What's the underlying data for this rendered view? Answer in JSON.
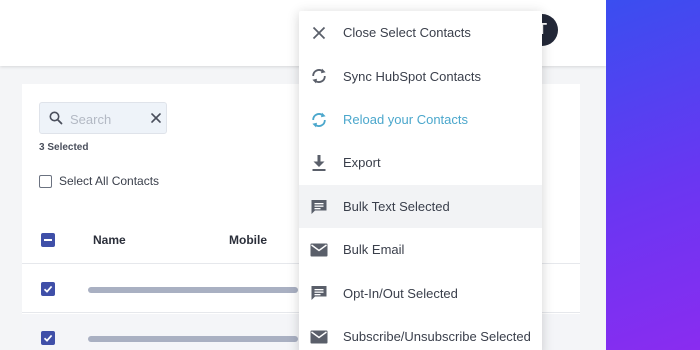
{
  "header": {
    "avatar_initial": "T"
  },
  "search": {
    "placeholder": "Search",
    "value": ""
  },
  "selection": {
    "count_text": "3 Selected",
    "select_all_label": "Select All Contacts"
  },
  "table": {
    "columns": [
      "Name",
      "Mobile"
    ],
    "rows": [
      {
        "checked": true
      },
      {
        "checked": true
      }
    ]
  },
  "menu": {
    "items": [
      {
        "icon": "close-icon",
        "label": "Close Select Contacts"
      },
      {
        "icon": "sync-icon",
        "label": "Sync HubSpot Contacts"
      },
      {
        "icon": "reload-icon",
        "label": "Reload your Contacts"
      },
      {
        "icon": "download-icon",
        "label": "Export"
      },
      {
        "icon": "message-icon",
        "label": "Bulk Text Selected"
      },
      {
        "icon": "mail-icon",
        "label": "Bulk Email"
      },
      {
        "icon": "message-icon",
        "label": "Opt-In/Out Selected"
      },
      {
        "icon": "mail-icon",
        "label": "Subscribe/Unsubscribe Selected"
      }
    ]
  },
  "colors": {
    "accent": "#4ba7cc",
    "checkbox": "#3f4fa8",
    "gradient_start": "#3a4ef0",
    "gradient_end": "#8a2cf0"
  }
}
